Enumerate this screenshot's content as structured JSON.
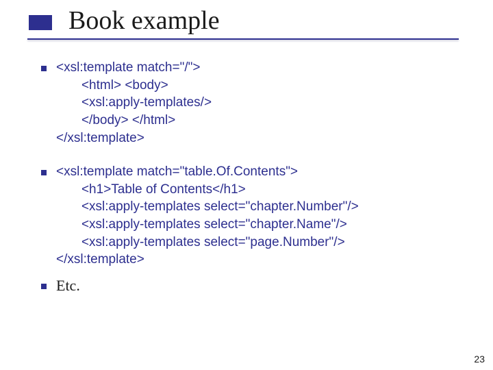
{
  "title": "Book example",
  "items": [
    {
      "lines": [
        "<xsl:template match=\"/\">",
        "       <html> <body>",
        "       <xsl:apply-templates/>",
        "       </body> </html>",
        "</xsl:template>"
      ]
    },
    {
      "lines": [
        "<xsl:template match=\"table.Of.Contents\">",
        "       <h1>Table of Contents</h1>",
        "       <xsl:apply-templates select=\"chapter.Number\"/>",
        "       <xsl:apply-templates select=\"chapter.Name\"/>",
        "       <xsl:apply-templates select=\"page.Number\"/>",
        "</xsl:template>"
      ]
    }
  ],
  "etc": "Etc.",
  "page_number": "23"
}
